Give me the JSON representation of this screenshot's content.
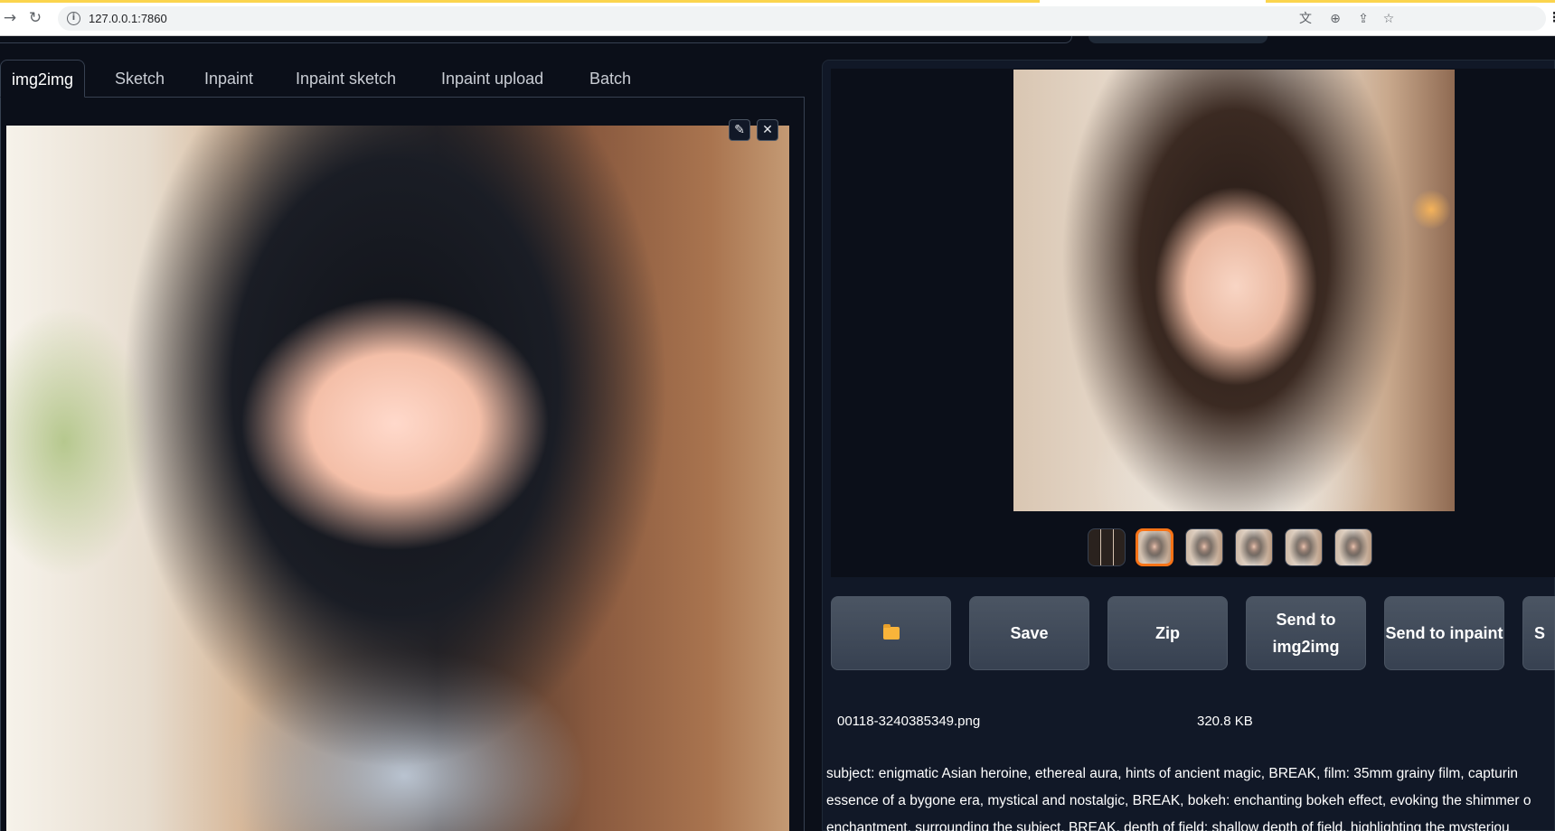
{
  "browser": {
    "url": "127.0.0.1:7860"
  },
  "tabs": [
    {
      "label": "img2img",
      "active": true
    },
    {
      "label": "Sketch"
    },
    {
      "label": "Inpaint"
    },
    {
      "label": "Inpaint sketch"
    },
    {
      "label": "Inpaint upload"
    },
    {
      "label": "Batch"
    }
  ],
  "image_tools": {
    "edit_icon": "✎",
    "clear_icon": "✕"
  },
  "buttons": {
    "save": "Save",
    "zip": "Zip",
    "send_img2img": "Send to img2img",
    "send_inpaint": "Send to inpaint",
    "send_extras_partial": "S"
  },
  "output": {
    "file_name": "00118-3240385349.png",
    "file_size": "320.8 KB",
    "info_lines": [
      "subject: enigmatic Asian heroine, ethereal aura, hints of ancient magic, BREAK, film: 35mm grainy film, capturin",
      "essence of a bygone era, mystical and nostalgic, BREAK, bokeh: enchanting bokeh effect, evoking the shimmer o",
      "enchantment, surrounding the subject, BREAK, depth of field: shallow depth of field, highlighting the mysteriou"
    ]
  },
  "colors": {
    "background": "#0b0f19",
    "panel": "#111827",
    "button": "#4b5563",
    "selected_thumb": "#f97316",
    "chrome_accent": "#fbd44d"
  }
}
